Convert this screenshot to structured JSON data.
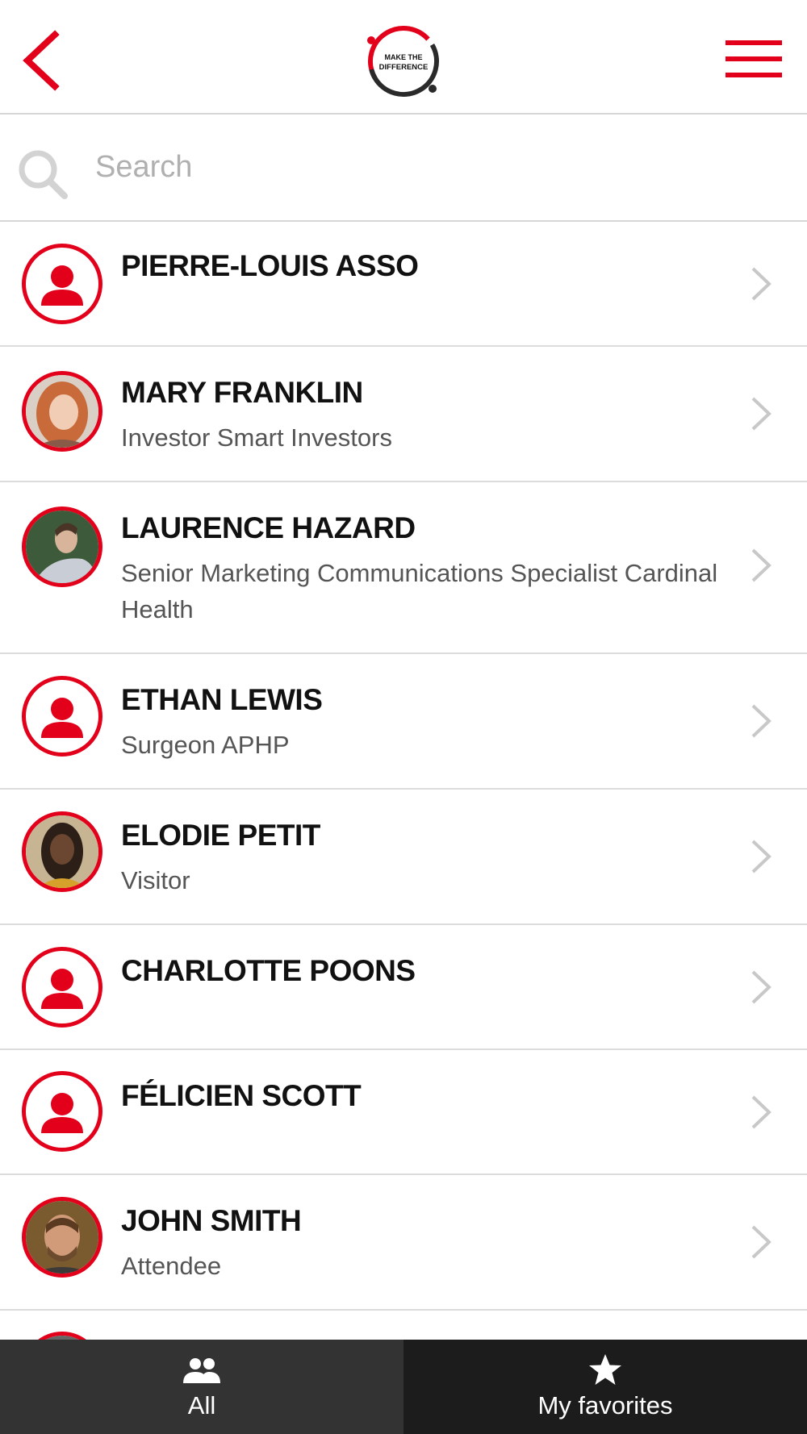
{
  "header": {
    "logo_text_line1": "MAKE THE",
    "logo_text_line2": "DIFFERENCE",
    "accent_color": "#e3001b"
  },
  "search": {
    "placeholder": "Search"
  },
  "attendees": [
    {
      "name": "PIERRE-LOUIS ASSO",
      "subtitle": "",
      "avatar": "placeholder-person-icon"
    },
    {
      "name": "MARY FRANKLIN",
      "subtitle": "Investor Smart Investors",
      "avatar": "photo"
    },
    {
      "name": "LAURENCE HAZARD",
      "subtitle": "Senior Marketing Communications Specialist Cardinal Health",
      "avatar": "photo"
    },
    {
      "name": "ETHAN LEWIS",
      "subtitle": "Surgeon APHP",
      "avatar": "placeholder-person-icon"
    },
    {
      "name": "ELODIE PETIT",
      "subtitle": "Visitor",
      "avatar": "photo"
    },
    {
      "name": "CHARLOTTE POONS",
      "subtitle": "",
      "avatar": "placeholder-person-icon"
    },
    {
      "name": "FÉLICIEN SCOTT",
      "subtitle": "",
      "avatar": "placeholder-person-icon"
    },
    {
      "name": "JOHN SMITH",
      "subtitle": "Attendee",
      "avatar": "photo"
    }
  ],
  "tabs": {
    "all": {
      "label": "All",
      "icon": "people-icon"
    },
    "favorites": {
      "label": "My favorites",
      "icon": "star-icon"
    }
  }
}
